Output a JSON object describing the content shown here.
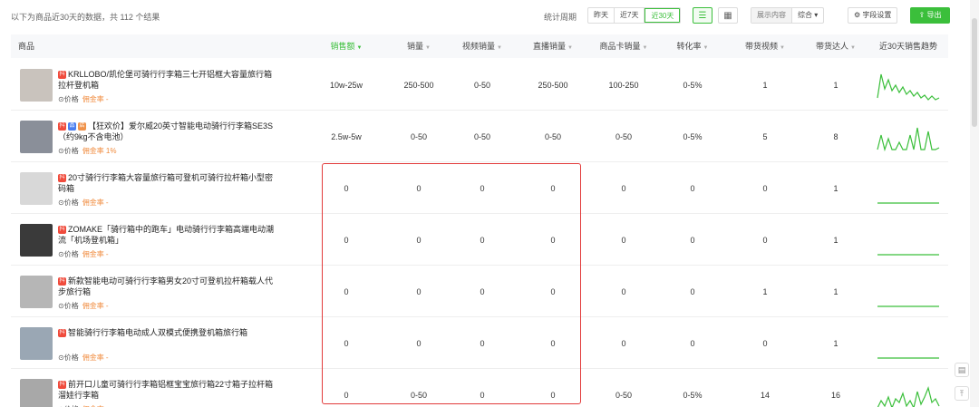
{
  "topbar": {
    "summary": "以下为商品近30天的数据，共 112 个结果",
    "period_label": "统计周期",
    "period_options": [
      "昨天",
      "近7天",
      "近30天"
    ],
    "show_label": "展示内容",
    "show_value": "综合",
    "field_settings": "字段设置",
    "export": "导出"
  },
  "columns": {
    "product": "商品",
    "sales_amount": "销售额",
    "sales_volume": "销量",
    "video_sales": "视频销量",
    "live_sales": "直播销量",
    "card_sales": "商品卡销量",
    "conversion": "转化率",
    "videos": "带货视频",
    "influencers": "带货达人",
    "trend": "近30天销售趋势"
  },
  "meta": {
    "price": "价格",
    "commission": "佣金率 -",
    "commission_1": "佣金率 1%"
  },
  "rows": [
    {
      "name": "KRLLOBO/凯伦堡可骑行行李箱三七开铝框大容量旅行箱拉杆登机箱",
      "commission": "佣金率 -",
      "sales_amount": "10w-25w",
      "sales_volume": "250-500",
      "video_sales": "0-50",
      "live_sales": "250-500",
      "card_sales": "100-250",
      "conversion": "0-5%",
      "videos": "1",
      "influencers": "1"
    },
    {
      "name": "【狂欢价】爱尔威20英寸智能电动骑行行李箱SE3S（约9kg不含电池）",
      "commission": "佣金率 1%",
      "sales_amount": "2.5w-5w",
      "sales_volume": "0-50",
      "video_sales": "0-50",
      "live_sales": "0-50",
      "card_sales": "0-50",
      "conversion": "0-5%",
      "videos": "5",
      "influencers": "8"
    },
    {
      "name": "20寸骑行行李箱大容量旅行箱可登机可骑行拉杆箱小型密码箱",
      "commission": "佣金率 -",
      "sales_amount": "0",
      "sales_volume": "0",
      "video_sales": "0",
      "live_sales": "0",
      "card_sales": "0",
      "conversion": "0",
      "videos": "0",
      "influencers": "1"
    },
    {
      "name": "ZOMAKE「骑行箱中的跑车」电动骑行行李箱高端电动潮流「机场登机箱」",
      "commission": "佣金率 -",
      "sales_amount": "0",
      "sales_volume": "0",
      "video_sales": "0",
      "live_sales": "0",
      "card_sales": "0",
      "conversion": "0",
      "videos": "0",
      "influencers": "1"
    },
    {
      "name": "新款智能电动可骑行行李箱男女20寸可登机拉杆箱载人代步旅行箱",
      "commission": "佣金率 -",
      "sales_amount": "0",
      "sales_volume": "0",
      "video_sales": "0",
      "live_sales": "0",
      "card_sales": "0",
      "conversion": "0",
      "videos": "1",
      "influencers": "1"
    },
    {
      "name": "智能骑行行李箱电动成人双模式便携登机箱旅行箱",
      "commission": "佣金率 -",
      "sales_amount": "0",
      "sales_volume": "0",
      "video_sales": "0",
      "live_sales": "0",
      "card_sales": "0",
      "conversion": "0",
      "videos": "0",
      "influencers": "1"
    },
    {
      "name": "前开口儿童可骑行行李箱铝框宝宝旅行箱22寸箱子拉杆箱溜娃行李箱",
      "commission": "佣金率 -",
      "sales_amount": "0",
      "sales_volume": "0-50",
      "video_sales": "0",
      "live_sales": "0",
      "card_sales": "0-50",
      "conversion": "0-5%",
      "videos": "14",
      "influencers": "16"
    }
  ],
  "colors": {
    "accent": "#3bbf3b",
    "badge": "#f04b3c",
    "highlight": "#e23b3b"
  }
}
